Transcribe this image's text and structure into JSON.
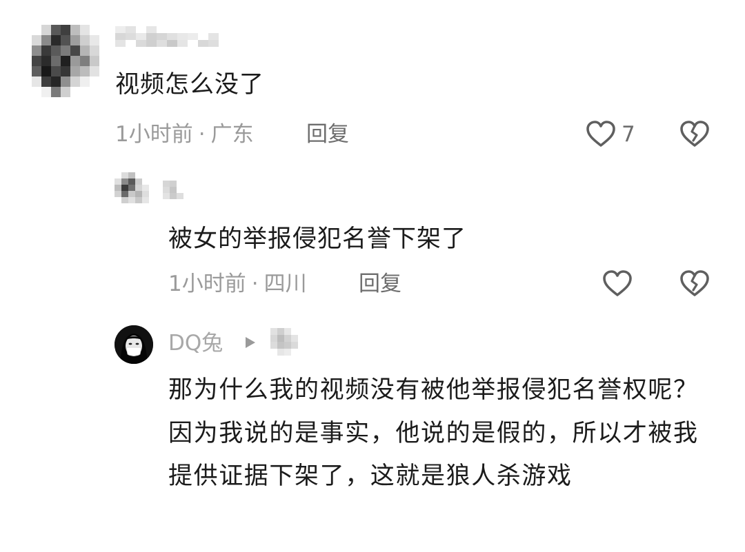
{
  "comments": [
    {
      "text": "视频怎么没了",
      "time": "1小时前",
      "location": "广东",
      "reply_label": "回复",
      "like_count": "7"
    },
    {
      "text": "被女的举报侵犯名誉下架了",
      "time": "1小时前",
      "location": "四川",
      "reply_label": "回复"
    },
    {
      "username": "DQ兔",
      "text": "那为什么我的视频没有被他举报侵犯名誉权呢？因为我说的是事实，他说的是假的，所以才被我提供证据下架了，这就是狼人杀游戏"
    }
  ],
  "colors": {
    "text": "#1b1b1b",
    "meta": "#9a9a9a",
    "reply": "#6d6d6d",
    "icon": "#5f5f5f"
  },
  "icons": {
    "like": "heart-outline-icon",
    "dislike": "broken-heart-outline-icon",
    "play": "play-triangle-icon"
  }
}
